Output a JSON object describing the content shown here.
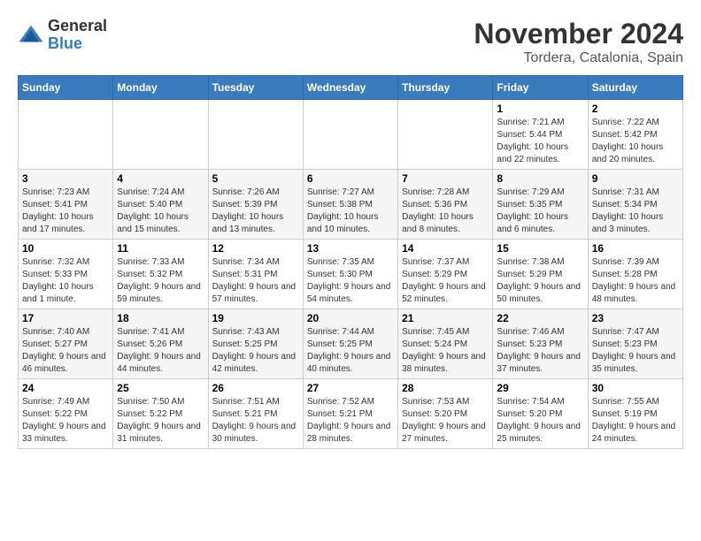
{
  "header": {
    "logo_general": "General",
    "logo_blue": "Blue",
    "month_title": "November 2024",
    "location": "Tordera, Catalonia, Spain"
  },
  "days_of_week": [
    "Sunday",
    "Monday",
    "Tuesday",
    "Wednesday",
    "Thursday",
    "Friday",
    "Saturday"
  ],
  "weeks": [
    [
      {
        "day": "",
        "info": ""
      },
      {
        "day": "",
        "info": ""
      },
      {
        "day": "",
        "info": ""
      },
      {
        "day": "",
        "info": ""
      },
      {
        "day": "",
        "info": ""
      },
      {
        "day": "1",
        "info": "Sunrise: 7:21 AM\nSunset: 5:44 PM\nDaylight: 10 hours and 22 minutes."
      },
      {
        "day": "2",
        "info": "Sunrise: 7:22 AM\nSunset: 5:42 PM\nDaylight: 10 hours and 20 minutes."
      }
    ],
    [
      {
        "day": "3",
        "info": "Sunrise: 7:23 AM\nSunset: 5:41 PM\nDaylight: 10 hours and 17 minutes."
      },
      {
        "day": "4",
        "info": "Sunrise: 7:24 AM\nSunset: 5:40 PM\nDaylight: 10 hours and 15 minutes."
      },
      {
        "day": "5",
        "info": "Sunrise: 7:26 AM\nSunset: 5:39 PM\nDaylight: 10 hours and 13 minutes."
      },
      {
        "day": "6",
        "info": "Sunrise: 7:27 AM\nSunset: 5:38 PM\nDaylight: 10 hours and 10 minutes."
      },
      {
        "day": "7",
        "info": "Sunrise: 7:28 AM\nSunset: 5:36 PM\nDaylight: 10 hours and 8 minutes."
      },
      {
        "day": "8",
        "info": "Sunrise: 7:29 AM\nSunset: 5:35 PM\nDaylight: 10 hours and 6 minutes."
      },
      {
        "day": "9",
        "info": "Sunrise: 7:31 AM\nSunset: 5:34 PM\nDaylight: 10 hours and 3 minutes."
      }
    ],
    [
      {
        "day": "10",
        "info": "Sunrise: 7:32 AM\nSunset: 5:33 PM\nDaylight: 10 hours and 1 minute."
      },
      {
        "day": "11",
        "info": "Sunrise: 7:33 AM\nSunset: 5:32 PM\nDaylight: 9 hours and 59 minutes."
      },
      {
        "day": "12",
        "info": "Sunrise: 7:34 AM\nSunset: 5:31 PM\nDaylight: 9 hours and 57 minutes."
      },
      {
        "day": "13",
        "info": "Sunrise: 7:35 AM\nSunset: 5:30 PM\nDaylight: 9 hours and 54 minutes."
      },
      {
        "day": "14",
        "info": "Sunrise: 7:37 AM\nSunset: 5:29 PM\nDaylight: 9 hours and 52 minutes."
      },
      {
        "day": "15",
        "info": "Sunrise: 7:38 AM\nSunset: 5:29 PM\nDaylight: 9 hours and 50 minutes."
      },
      {
        "day": "16",
        "info": "Sunrise: 7:39 AM\nSunset: 5:28 PM\nDaylight: 9 hours and 48 minutes."
      }
    ],
    [
      {
        "day": "17",
        "info": "Sunrise: 7:40 AM\nSunset: 5:27 PM\nDaylight: 9 hours and 46 minutes."
      },
      {
        "day": "18",
        "info": "Sunrise: 7:41 AM\nSunset: 5:26 PM\nDaylight: 9 hours and 44 minutes."
      },
      {
        "day": "19",
        "info": "Sunrise: 7:43 AM\nSunset: 5:25 PM\nDaylight: 9 hours and 42 minutes."
      },
      {
        "day": "20",
        "info": "Sunrise: 7:44 AM\nSunset: 5:25 PM\nDaylight: 9 hours and 40 minutes."
      },
      {
        "day": "21",
        "info": "Sunrise: 7:45 AM\nSunset: 5:24 PM\nDaylight: 9 hours and 38 minutes."
      },
      {
        "day": "22",
        "info": "Sunrise: 7:46 AM\nSunset: 5:23 PM\nDaylight: 9 hours and 37 minutes."
      },
      {
        "day": "23",
        "info": "Sunrise: 7:47 AM\nSunset: 5:23 PM\nDaylight: 9 hours and 35 minutes."
      }
    ],
    [
      {
        "day": "24",
        "info": "Sunrise: 7:49 AM\nSunset: 5:22 PM\nDaylight: 9 hours and 33 minutes."
      },
      {
        "day": "25",
        "info": "Sunrise: 7:50 AM\nSunset: 5:22 PM\nDaylight: 9 hours and 31 minutes."
      },
      {
        "day": "26",
        "info": "Sunrise: 7:51 AM\nSunset: 5:21 PM\nDaylight: 9 hours and 30 minutes."
      },
      {
        "day": "27",
        "info": "Sunrise: 7:52 AM\nSunset: 5:21 PM\nDaylight: 9 hours and 28 minutes."
      },
      {
        "day": "28",
        "info": "Sunrise: 7:53 AM\nSunset: 5:20 PM\nDaylight: 9 hours and 27 minutes."
      },
      {
        "day": "29",
        "info": "Sunrise: 7:54 AM\nSunset: 5:20 PM\nDaylight: 9 hours and 25 minutes."
      },
      {
        "day": "30",
        "info": "Sunrise: 7:55 AM\nSunset: 5:19 PM\nDaylight: 9 hours and 24 minutes."
      }
    ]
  ]
}
